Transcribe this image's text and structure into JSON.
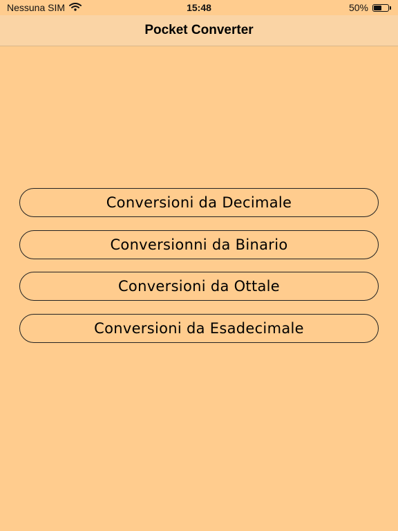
{
  "status_bar": {
    "carrier": "Nessuna SIM",
    "wifi_icon": "wifi-icon",
    "time": "15:48",
    "battery_percent": "50%",
    "battery_icon": "battery-icon",
    "battery_level": 0.5
  },
  "nav": {
    "title": "Pocket Converter"
  },
  "menu": {
    "buttons": [
      {
        "label": "Conversioni da Decimale"
      },
      {
        "label": "Conversionni da Binario"
      },
      {
        "label": "Conversioni da Ottale"
      },
      {
        "label": "Conversioni da Esadecimale"
      }
    ]
  },
  "colors": {
    "background": "#FFCC8E",
    "nav_background": "#FAD4A5",
    "button_border": "#222222",
    "text": "#000000"
  }
}
